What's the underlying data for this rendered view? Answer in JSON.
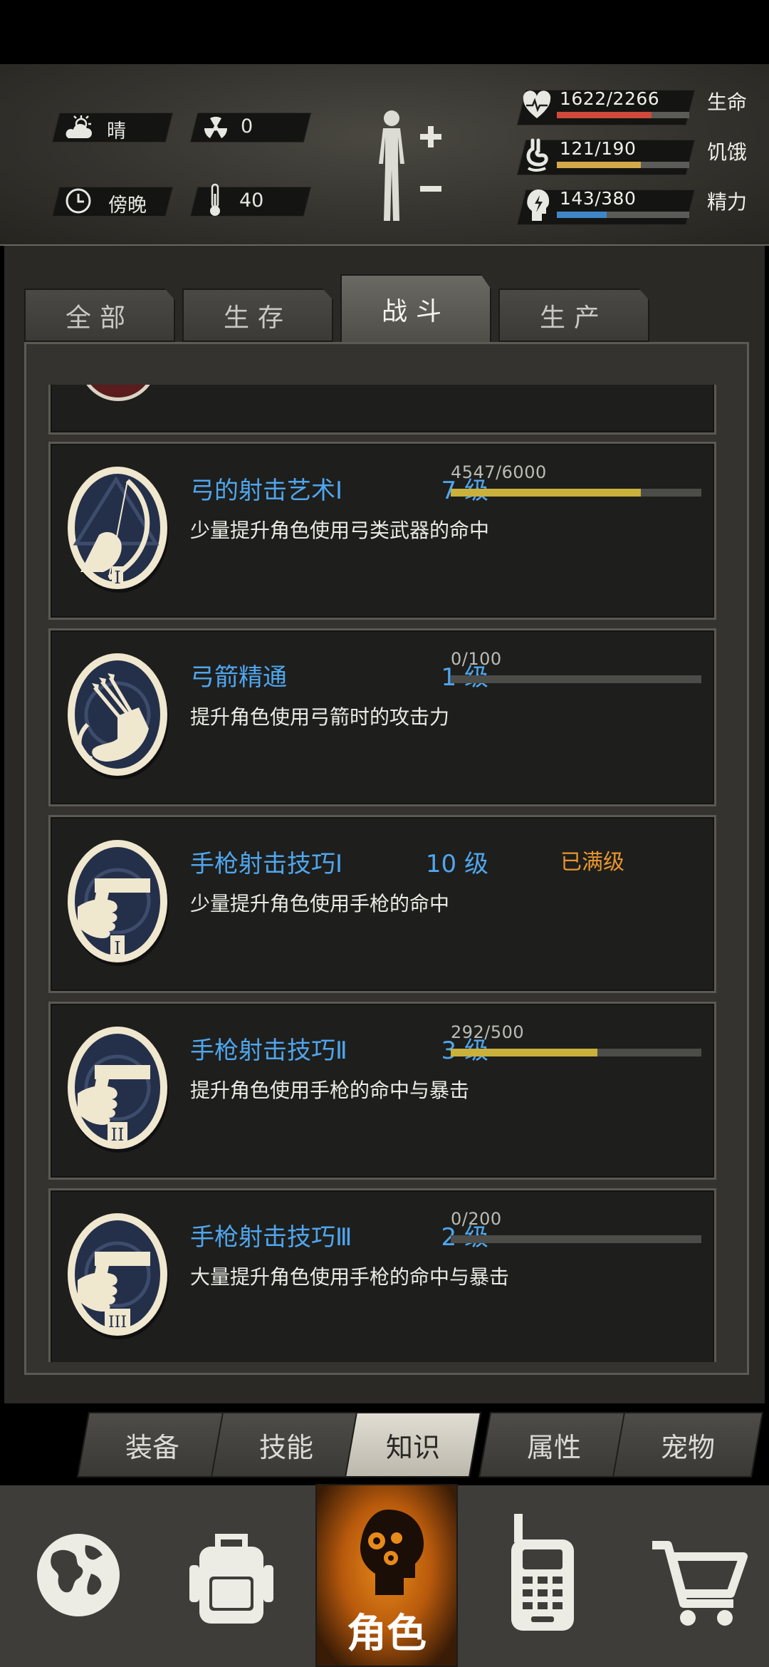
{
  "hud": {
    "weather": "晴",
    "radiation": "0",
    "time_of_day": "傍晚",
    "temperature": "40",
    "stats": [
      {
        "label": "生命",
        "value": "1622/2266",
        "fraction": 0.716,
        "color": "#cf4a3a"
      },
      {
        "label": "饥饿",
        "value": "121/190",
        "fraction": 0.637,
        "color": "#d4a84a"
      },
      {
        "label": "精力",
        "value": "143/380",
        "fraction": 0.376,
        "color": "#3f86c9"
      }
    ]
  },
  "tabs": [
    "全部",
    "生存",
    "战斗",
    "生产"
  ],
  "active_tab": "战斗",
  "skills": [
    {
      "name": "弓的射击艺术Ⅰ",
      "level": "7 级",
      "xp": "4547/6000",
      "fraction": 0.758,
      "desc": "少量提升角色使用弓类武器的命中",
      "icon": "bow-icon",
      "roman": "I"
    },
    {
      "name": "弓箭精通",
      "level": "1 级",
      "xp": "0/100",
      "fraction": 0,
      "desc": "提升角色使用弓箭时的攻击力",
      "icon": "quiver-icon",
      "roman": ""
    },
    {
      "name": "手枪射击技巧Ⅰ",
      "level": "10 级",
      "maxed": "已满级",
      "desc": "少量提升角色使用手枪的命中",
      "icon": "pistol-icon",
      "roman": "I"
    },
    {
      "name": "手枪射击技巧Ⅱ",
      "level": "3 级",
      "xp": "292/500",
      "fraction": 0.584,
      "desc": "提升角色使用手枪的命中与暴击",
      "icon": "pistol-icon",
      "roman": "II"
    },
    {
      "name": "手枪射击技巧Ⅲ",
      "level": "2 级",
      "xp": "0/200",
      "fraction": 0,
      "desc": "大量提升角色使用手枪的命中与暴击",
      "icon": "pistol-icon",
      "roman": "III"
    }
  ],
  "subtabs": [
    "装备",
    "技能",
    "知识",
    "属性",
    "宠物"
  ],
  "active_subtab": "知识",
  "bottom_nav": {
    "items": [
      "globe-icon",
      "backpack-icon",
      "character-icon",
      "radio-icon",
      "cart-icon"
    ],
    "active_label": "角色"
  }
}
